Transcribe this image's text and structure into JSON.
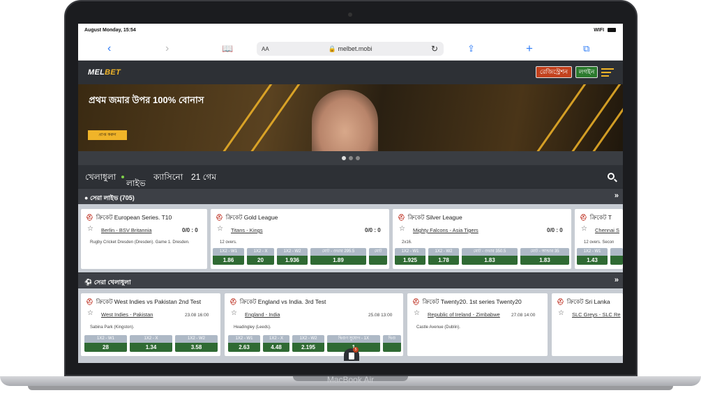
{
  "status_bar": {
    "time": "August Monday, 15:54",
    "signal": "WIFI"
  },
  "safari": {
    "text_size_label": "AA",
    "url": "melbet.mobi",
    "icons": [
      "back-icon",
      "forward-icon",
      "bookmarks-icon",
      "reload-icon",
      "share-icon",
      "new-tab-icon",
      "tabs-icon"
    ]
  },
  "site": {
    "logo_part1": "MEL",
    "logo_part2": "BET",
    "register_label": "রেজিস্ট্রেশন",
    "login_label": "লগইন"
  },
  "banner": {
    "title": "প্রথম জমার উপর 100% বোনাস",
    "button_label": "প্রাপ্ত করুন"
  },
  "nav": {
    "sports": "খেলাধুলা",
    "live": "লাইভ",
    "casino": "ক্যাসিনো",
    "games": "21 গেম"
  },
  "top_live": {
    "title": "সেরা লাইভ (705)",
    "cards": [
      {
        "sport": "ক্রিকেট",
        "league": "European Series. T10",
        "teams": "Berlin - BSV Britannia",
        "score": "0/0 : 0",
        "info": "Rugby Cricket Dresden (Dresden). Game 1. Dresden.",
        "odds": []
      },
      {
        "sport": "ক্রিকেট",
        "league": "Gold League",
        "teams": "Titans - Kings",
        "score": "0/0 : 0",
        "info": "12 overs.",
        "odds": [
          {
            "label": "1X2 - W1",
            "value": "1.86"
          },
          {
            "label": "1X2 - X",
            "value": "20"
          },
          {
            "label": "1X2 - W2",
            "value": "1.936"
          },
          {
            "label": "মোট - ওভার 295.5",
            "value": "1.89"
          },
          {
            "label": "মোট",
            "value": ""
          }
        ]
      },
      {
        "sport": "ক্রিকেট",
        "league": "Silver League",
        "teams": "Mighty Falcons - Asia Tigers",
        "score": "0/0 : 0",
        "info": "2x16.",
        "odds": [
          {
            "label": "1X2 - W1",
            "value": "1.925"
          },
          {
            "label": "1X2 - W2",
            "value": "1.78"
          },
          {
            "label": "মোট - ওভার 350.5",
            "value": "1.83"
          },
          {
            "label": "মোট - আন্ডার 35",
            "value": "1.83"
          }
        ]
      },
      {
        "sport": "ক্রিকেট",
        "league": "T",
        "teams": "Chennai S",
        "score": "",
        "info": "12 overs. Secon",
        "odds": [
          {
            "label": "1X2 - W1",
            "value": "1.43"
          },
          {
            "label": "",
            "value": ""
          }
        ]
      }
    ]
  },
  "top_sports": {
    "title": "সেরা খেলাধুলা",
    "cards": [
      {
        "sport": "ক্রিকেট",
        "league": "West Indies vs Pakistan 2nd Test",
        "teams": "West Indies - Pakistan",
        "date": "23.08 16:00",
        "info": "Sabina Park (Kingston).",
        "odds": [
          {
            "label": "1X2 - W1",
            "value": "28"
          },
          {
            "label": "1X2 - X",
            "value": "1.34"
          },
          {
            "label": "1X2 - W2",
            "value": "3.58"
          }
        ]
      },
      {
        "sport": "ক্রিকেট",
        "league": "England vs India. 3rd Test",
        "teams": "England - India",
        "date": "25.08 13:00",
        "info": "Headingley (Leeds).",
        "odds": [
          {
            "label": "1X2 - W1",
            "value": "2.63"
          },
          {
            "label": "1X2 - X",
            "value": "4.48"
          },
          {
            "label": "1X2 - W2",
            "value": "2.195"
          },
          {
            "label": "দ্বিগুণ সুযোগ - 1X",
            "value": "1"
          },
          {
            "label": "দ্বিগু",
            "value": ""
          }
        ]
      },
      {
        "sport": "ক্রিকেট",
        "league": "Twenty20. 1st series Twenty20",
        "teams": "Republic of Ireland - Zimbabwe",
        "date": "27.08 14:00",
        "info": "Castle Avenue (Dublin).",
        "odds": []
      },
      {
        "sport": "ক্রিকেট",
        "league": "Sri Lanka",
        "teams": "SLC Greys - SLC Re",
        "date": "",
        "info": "",
        "odds": []
      }
    ]
  },
  "chat_badge": "5",
  "device_label": "MacBook Air"
}
